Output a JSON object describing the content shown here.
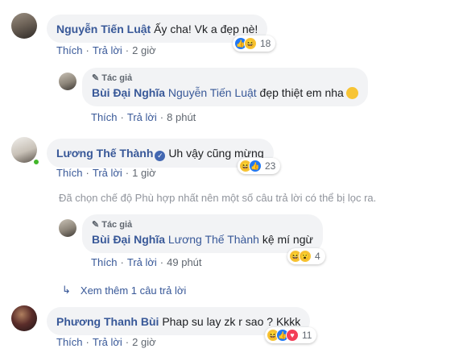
{
  "comments": [
    {
      "author": "Nguyễn Tiến Luật",
      "text": "Ấy cha! Vk a đẹp nè!",
      "actions": {
        "like": "Thích",
        "reply": "Trả lời",
        "time": "2 giờ"
      },
      "reaction_count": "18",
      "reaction_icons": [
        "like-icon",
        "haha-icon"
      ]
    },
    {
      "author_tag": "Tác giả",
      "author": "Bùi Đại Nghĩa",
      "tagged": "Nguyễn Tiến Luật",
      "text": "đẹp thiệt em nha",
      "emoji": "grinning-face-icon",
      "actions": {
        "like": "Thích",
        "reply": "Trả lời",
        "time": "8 phút"
      }
    },
    {
      "author": "Lương Thế Thành",
      "verified_icon": "verified-badge-icon",
      "text": "Uh vậy cũng mừng",
      "actions": {
        "like": "Thích",
        "reply": "Trả lời",
        "time": "1 giờ"
      },
      "reaction_count": "23",
      "reaction_icons": [
        "haha-icon",
        "like-icon"
      ]
    },
    {
      "author_tag": "Tác giả",
      "author": "Bùi Đại Nghĩa",
      "tagged": "Lương Thế Thành",
      "text": "kệ mí ngừ",
      "actions": {
        "like": "Thích",
        "reply": "Trả lời",
        "time": "49 phút"
      },
      "reaction_count": "4",
      "reaction_icons": [
        "haha-icon",
        "wow-icon"
      ]
    },
    {
      "author": "Phương Thanh Bùi",
      "text": "Phap su lay zk r sao ? Kkkk",
      "actions": {
        "like": "Thích",
        "reply": "Trả lời",
        "time": "2 giờ"
      },
      "reaction_count": "11",
      "reaction_icons": [
        "haha-icon",
        "like-icon",
        "love-icon"
      ]
    }
  ],
  "filter_note": "Đã chọn chế độ Phù hợp nhất nên một số câu trả lời có thể bị lọc ra.",
  "more_replies": "Xem thêm 1 câu trả lời",
  "colors": {
    "link": "#385898",
    "muted": "#606770",
    "bubble": "#f2f3f5",
    "online": "#42b72a"
  }
}
